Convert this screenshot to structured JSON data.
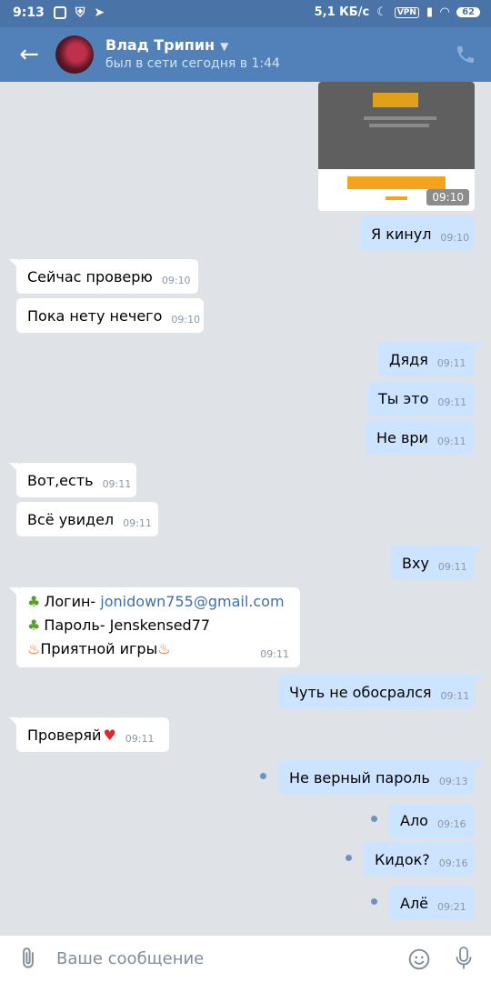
{
  "status_bar": {
    "time": "9:13",
    "speed": "5,1 КБ/с",
    "vpn": "VPN",
    "battery": "62"
  },
  "header": {
    "name": "Влад Трипин",
    "status": "был в сети сегодня в 1:44"
  },
  "photo": {
    "time": "09:10"
  },
  "messages": [
    {
      "text": "Я кинул",
      "time": "09:10"
    },
    {
      "text": "Сейчас проверю",
      "time": "09:10"
    },
    {
      "text": "Пока нету нечего",
      "time": "09:10"
    },
    {
      "text": "Дядя",
      "time": "09:11"
    },
    {
      "text": "Ты это",
      "time": "09:11"
    },
    {
      "text": "Не ври",
      "time": "09:11"
    },
    {
      "text": "Вот,есть",
      "time": "09:11"
    },
    {
      "text": "Всё увидел",
      "time": "09:11"
    },
    {
      "text": "Вху",
      "time": "09:11"
    },
    {
      "login_label": "Логин- ",
      "login_value": "jonidown755@gmail.com",
      "password_line": "Пароль- Jenskensed77",
      "game_line": "Приятной игры",
      "time": "09:11"
    },
    {
      "text": "Чуть не обосрался",
      "time": "09:11"
    },
    {
      "text": "Проверяй",
      "time": "09:11"
    },
    {
      "text": "Не верный пароль",
      "time": "09:13"
    },
    {
      "text": "Ало",
      "time": "09:16"
    },
    {
      "text": "Кидок?",
      "time": "09:16"
    },
    {
      "text": "Алё",
      "time": "09:21"
    }
  ],
  "input": {
    "placeholder": "Ваше сообщение"
  },
  "icons": {
    "back": "arrow-left-icon",
    "call": "phone-icon",
    "attach": "paperclip-icon",
    "emoji": "smile-icon",
    "mic": "microphone-icon"
  },
  "colors": {
    "header": "#5181b8",
    "status_bar": "#4a73a7",
    "outgoing_bubble": "#cce4ff",
    "incoming_bubble": "#ffffff",
    "chat_background": "#dfe3e8",
    "link": "#3f6fa6"
  }
}
